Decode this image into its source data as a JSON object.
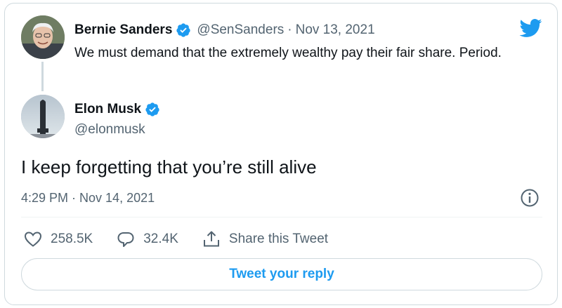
{
  "parent_tweet": {
    "author_name": "Bernie Sanders",
    "handle": "@SenSanders",
    "separator": "·",
    "date": "Nov 13, 2021",
    "text": "We must demand that the extremely wealthy pay their fair share. Period.",
    "verified": true
  },
  "tweet": {
    "author_name": "Elon Musk",
    "handle": "@elonmusk",
    "verified": true,
    "text": "I keep forgetting that you’re still alive",
    "timestamp": "4:29 PM · Nov 14, 2021"
  },
  "actions": {
    "likes": "258.5K",
    "replies": "32.4K",
    "share_label": "Share this Tweet"
  },
  "reply_button_label": "Tweet your reply",
  "icons": {
    "brand": "twitter-bird-icon",
    "verified": "verified-badge-icon",
    "info": "info-icon",
    "like": "heart-icon",
    "reply": "reply-bubble-icon",
    "share": "share-icon"
  },
  "colors": {
    "accent": "#1d9bf0",
    "text": "#0f1419",
    "secondary": "#536471",
    "border": "#cfd9de"
  }
}
